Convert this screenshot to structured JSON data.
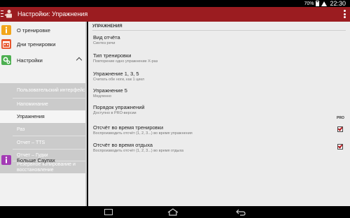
{
  "status_bar": {
    "battery_percent": "70%",
    "time": "22:30"
  },
  "action_bar": {
    "title": "Настройки: Упражнения",
    "overflow_icon": "overflow-menu-icon"
  },
  "sidebar": {
    "items": [
      {
        "label": "О тренировке",
        "icon": "info-icon",
        "color": "#f2a51a"
      },
      {
        "label": "Дни тренировки",
        "icon": "calendar-icon",
        "color": "#e8552c"
      },
      {
        "label": "Настройки",
        "icon": "gears-icon",
        "color": "#4caf50"
      }
    ],
    "sub_items": [
      {
        "label": "Пользовательский интерфейс"
      },
      {
        "label": "Напоминание"
      },
      {
        "label": "Упражнения",
        "active": true
      },
      {
        "label": "Раз"
      },
      {
        "label": "Отчет – TTS"
      },
      {
        "label": "Отчет – Гудки"
      },
      {
        "label": "Резервное копирование и восстановление"
      }
    ],
    "more": {
      "label": "Больше Саупах",
      "icon": "info-icon",
      "color": "#a43bb5"
    }
  },
  "main": {
    "section_header": "УПРАЖНЕНИЯ",
    "pro_label": "PRO",
    "prefs": [
      {
        "title": "Вид отчёта",
        "summary": "Синтез речи"
      },
      {
        "title": "Тип тренировки",
        "summary": "Повторение одно упражнение X-раз"
      },
      {
        "title": "Упражнение 1, 3, 5",
        "summary": "Считать обе ноги, как 1 цикл"
      },
      {
        "title": "Упражнение 5",
        "summary": "Медленно"
      },
      {
        "title": "Порядок упражнений",
        "summary": "Доступно в PRO-версии"
      },
      {
        "title": "Отсчёт во время тренировки",
        "summary": "Воспроизводить отсчёт (1, 2, 3...) во время упражнения",
        "checked": true
      },
      {
        "title": "Отсчёт во время отдыха",
        "summary": "Воспроизводить отсчёт (1, 2, 3...) во время отдыха",
        "checked": true
      }
    ]
  }
}
